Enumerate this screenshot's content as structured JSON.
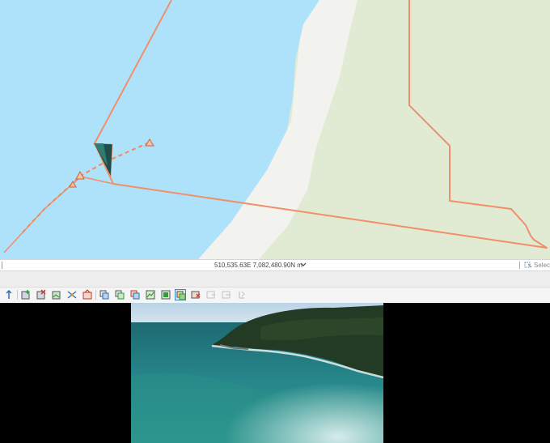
{
  "map": {
    "colors": {
      "water": "#aee2fa",
      "beach": "#f2f2ee",
      "land": "#e1ebd3",
      "track": "#f0906a",
      "camera_marker": "#ef8a5c"
    }
  },
  "status_bar": {
    "coordinates": "510,535.63E 7,082,480.90N m",
    "selection_label": "Selec"
  },
  "toolbar": {
    "buttons": [
      {
        "icon": "upload-arrow-icon"
      },
      {
        "icon": "add-frame-icon"
      },
      {
        "icon": "delete-frame-icon"
      },
      {
        "icon": "add-photo-icon"
      },
      {
        "icon": "split-icon"
      },
      {
        "icon": "home-camera-icon"
      },
      {
        "icon": "layer-copy-icon"
      },
      {
        "icon": "layer-merge-icon"
      },
      {
        "icon": "layer-color-icon"
      },
      {
        "icon": "image-add-icon"
      },
      {
        "icon": "image-remove-icon"
      },
      {
        "icon": "sync-view-icon"
      },
      {
        "icon": "flag-image-icon"
      },
      {
        "icon": "disabled-tool-1-icon"
      },
      {
        "icon": "disabled-tool-2-icon"
      },
      {
        "icon": "disabled-tool-3-icon"
      }
    ],
    "active_button": "sync-view-icon"
  },
  "viewer": {
    "colors": {
      "sky": "#b9d3e6",
      "sea_deep": "#1e6a73",
      "sea_shallow": "#2f9c93",
      "headland": "#233b24",
      "surf": "#e8f1ef"
    }
  }
}
